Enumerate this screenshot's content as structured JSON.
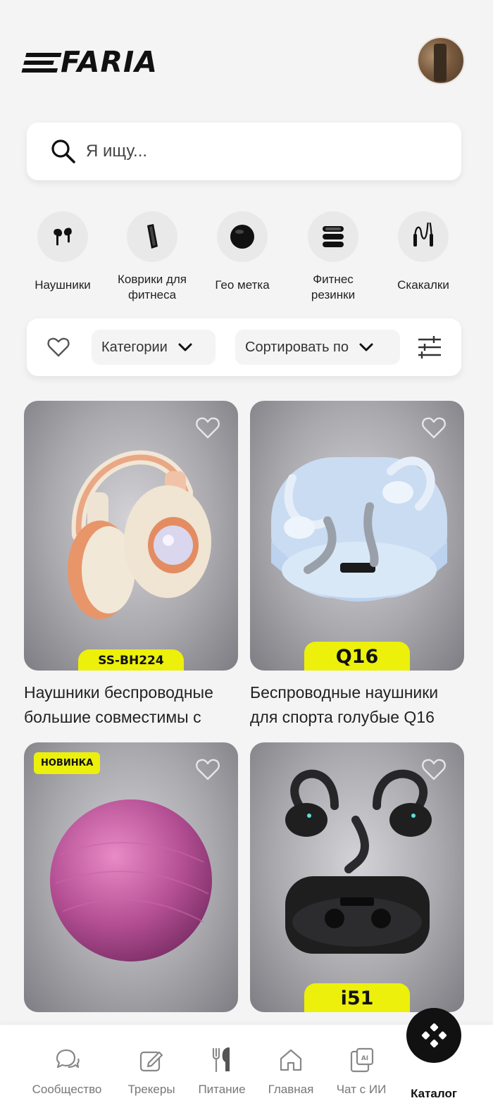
{
  "header": {
    "logo_text": "FARIA"
  },
  "search": {
    "placeholder": "Я ищу..."
  },
  "categories": [
    {
      "label": "Наушники",
      "icon": "earbuds-icon"
    },
    {
      "label": "Коврики для фитнеса",
      "icon": "yoga-mat-icon"
    },
    {
      "label": "Гео метка",
      "icon": "geo-tag-icon"
    },
    {
      "label": "Фитнес резинки",
      "icon": "resistance-bands-icon"
    },
    {
      "label": "Скакалки",
      "icon": "jump-rope-icon"
    }
  ],
  "filters": {
    "categories_label": "Категории",
    "sort_label": "Сортировать по"
  },
  "products": [
    {
      "title": "Наушники беспроводные большие совместимы с",
      "tag": "SS-BH224",
      "badge": "",
      "image": "headphones-image"
    },
    {
      "title": "Беспроводные наушники для спорта голубые Q16",
      "tag": "Q16",
      "badge": "",
      "image": "earbuds-blue-image"
    },
    {
      "title": "",
      "tag": "",
      "badge": "НОВИНКА",
      "image": "fitness-ball-image"
    },
    {
      "title": "",
      "tag": "i51",
      "badge": "",
      "image": "earbuds-black-image"
    }
  ],
  "tabbar": {
    "items": [
      {
        "label": "Сообщество",
        "icon": "community-icon"
      },
      {
        "label": "Трекеры",
        "icon": "tracker-edit-icon"
      },
      {
        "label": "Питание",
        "icon": "cutlery-icon"
      },
      {
        "label": "Главная",
        "icon": "home-icon"
      },
      {
        "label": "Чат с ИИ",
        "icon": "ai-chat-icon"
      },
      {
        "label": "Каталог",
        "icon": "catalog-icon"
      }
    ],
    "active": "Каталог"
  },
  "colors": {
    "accent": "#ECF00B",
    "background": "#F4F4F5",
    "dark": "#111111"
  }
}
